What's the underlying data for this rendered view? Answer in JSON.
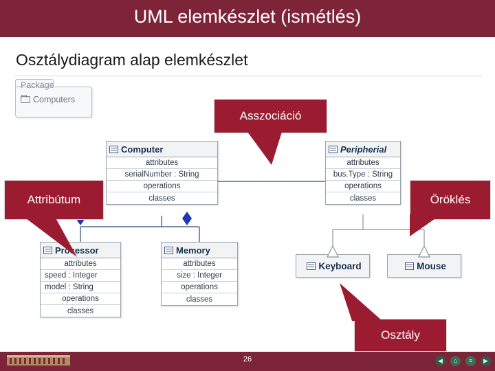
{
  "slide": {
    "title": "UML elemkészlet (ismétlés)",
    "subtitle": "Osztálydiagram alap elemkészlet",
    "page_number": "26",
    "colors": {
      "title_bar": "#7E2439",
      "callout": "#9B1B30",
      "callout_text": "#FFFFFF",
      "class_title": "#15314E"
    }
  },
  "package": {
    "label": "Package",
    "item": "Computers",
    "icon": "folder-icon"
  },
  "classes": [
    {
      "name": "Computer",
      "italic": false,
      "rows": [
        "attributes",
        "serialNumber : String",
        "operations",
        "classes"
      ]
    },
    {
      "name": "Peripherial",
      "italic": true,
      "rows": [
        "attributes",
        "bus.Type : String",
        "operations",
        "classes"
      ]
    },
    {
      "name": "Processor",
      "italic": false,
      "rows": [
        "attributes",
        "speed : Integer",
        "model : String",
        "operations",
        "classes"
      ]
    },
    {
      "name": "Memory",
      "italic": false,
      "rows": [
        "attributes",
        "size : Integer",
        "operations",
        "classes"
      ]
    },
    {
      "name": "Keyboard",
      "italic": false,
      "rows": []
    },
    {
      "name": "Mouse",
      "italic": false,
      "rows": []
    }
  ],
  "callouts": [
    {
      "id": "asszociacio",
      "label": "Asszociáció"
    },
    {
      "id": "attributum",
      "label": "Attribútum"
    },
    {
      "id": "oroklés",
      "label": "Öröklés"
    },
    {
      "id": "osztaly",
      "label": "Osztály"
    }
  ],
  "footer": {
    "nav": [
      {
        "name": "prev-slide-button",
        "glyph": "◀"
      },
      {
        "name": "home-button",
        "glyph": "⌂"
      },
      {
        "name": "menu-button",
        "glyph": "≡"
      },
      {
        "name": "next-slide-button",
        "glyph": "▶"
      }
    ]
  }
}
